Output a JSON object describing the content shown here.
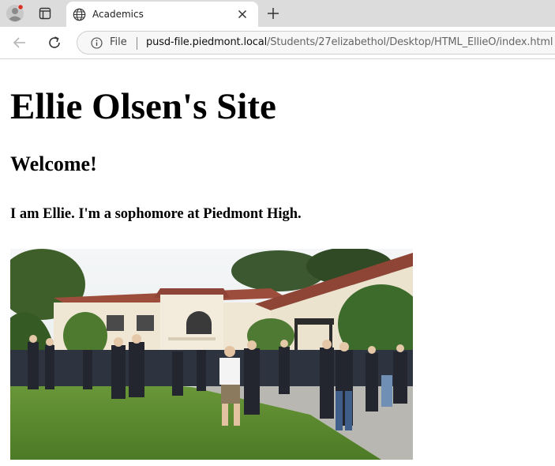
{
  "browser": {
    "tab": {
      "title": "Academics"
    },
    "address": {
      "scheme_label": "File",
      "host": "pusd-file.piedmont.local",
      "path": "/Students/27elizabethol/Desktop/HTML_EllieO/index.html"
    },
    "icons": [
      "profile-icon",
      "tab-actions-icon",
      "globe-icon",
      "close-icon",
      "new-tab-icon",
      "back-icon",
      "reload-icon",
      "info-icon"
    ],
    "colors": {
      "tabstrip": "#dcdcdc",
      "profile_badge": "#d93025"
    }
  },
  "page": {
    "heading": "Ellie Olsen's Site",
    "subheading": "Welcome!",
    "intro": "I am Ellie. I'm a sophomore at Piedmont High."
  }
}
